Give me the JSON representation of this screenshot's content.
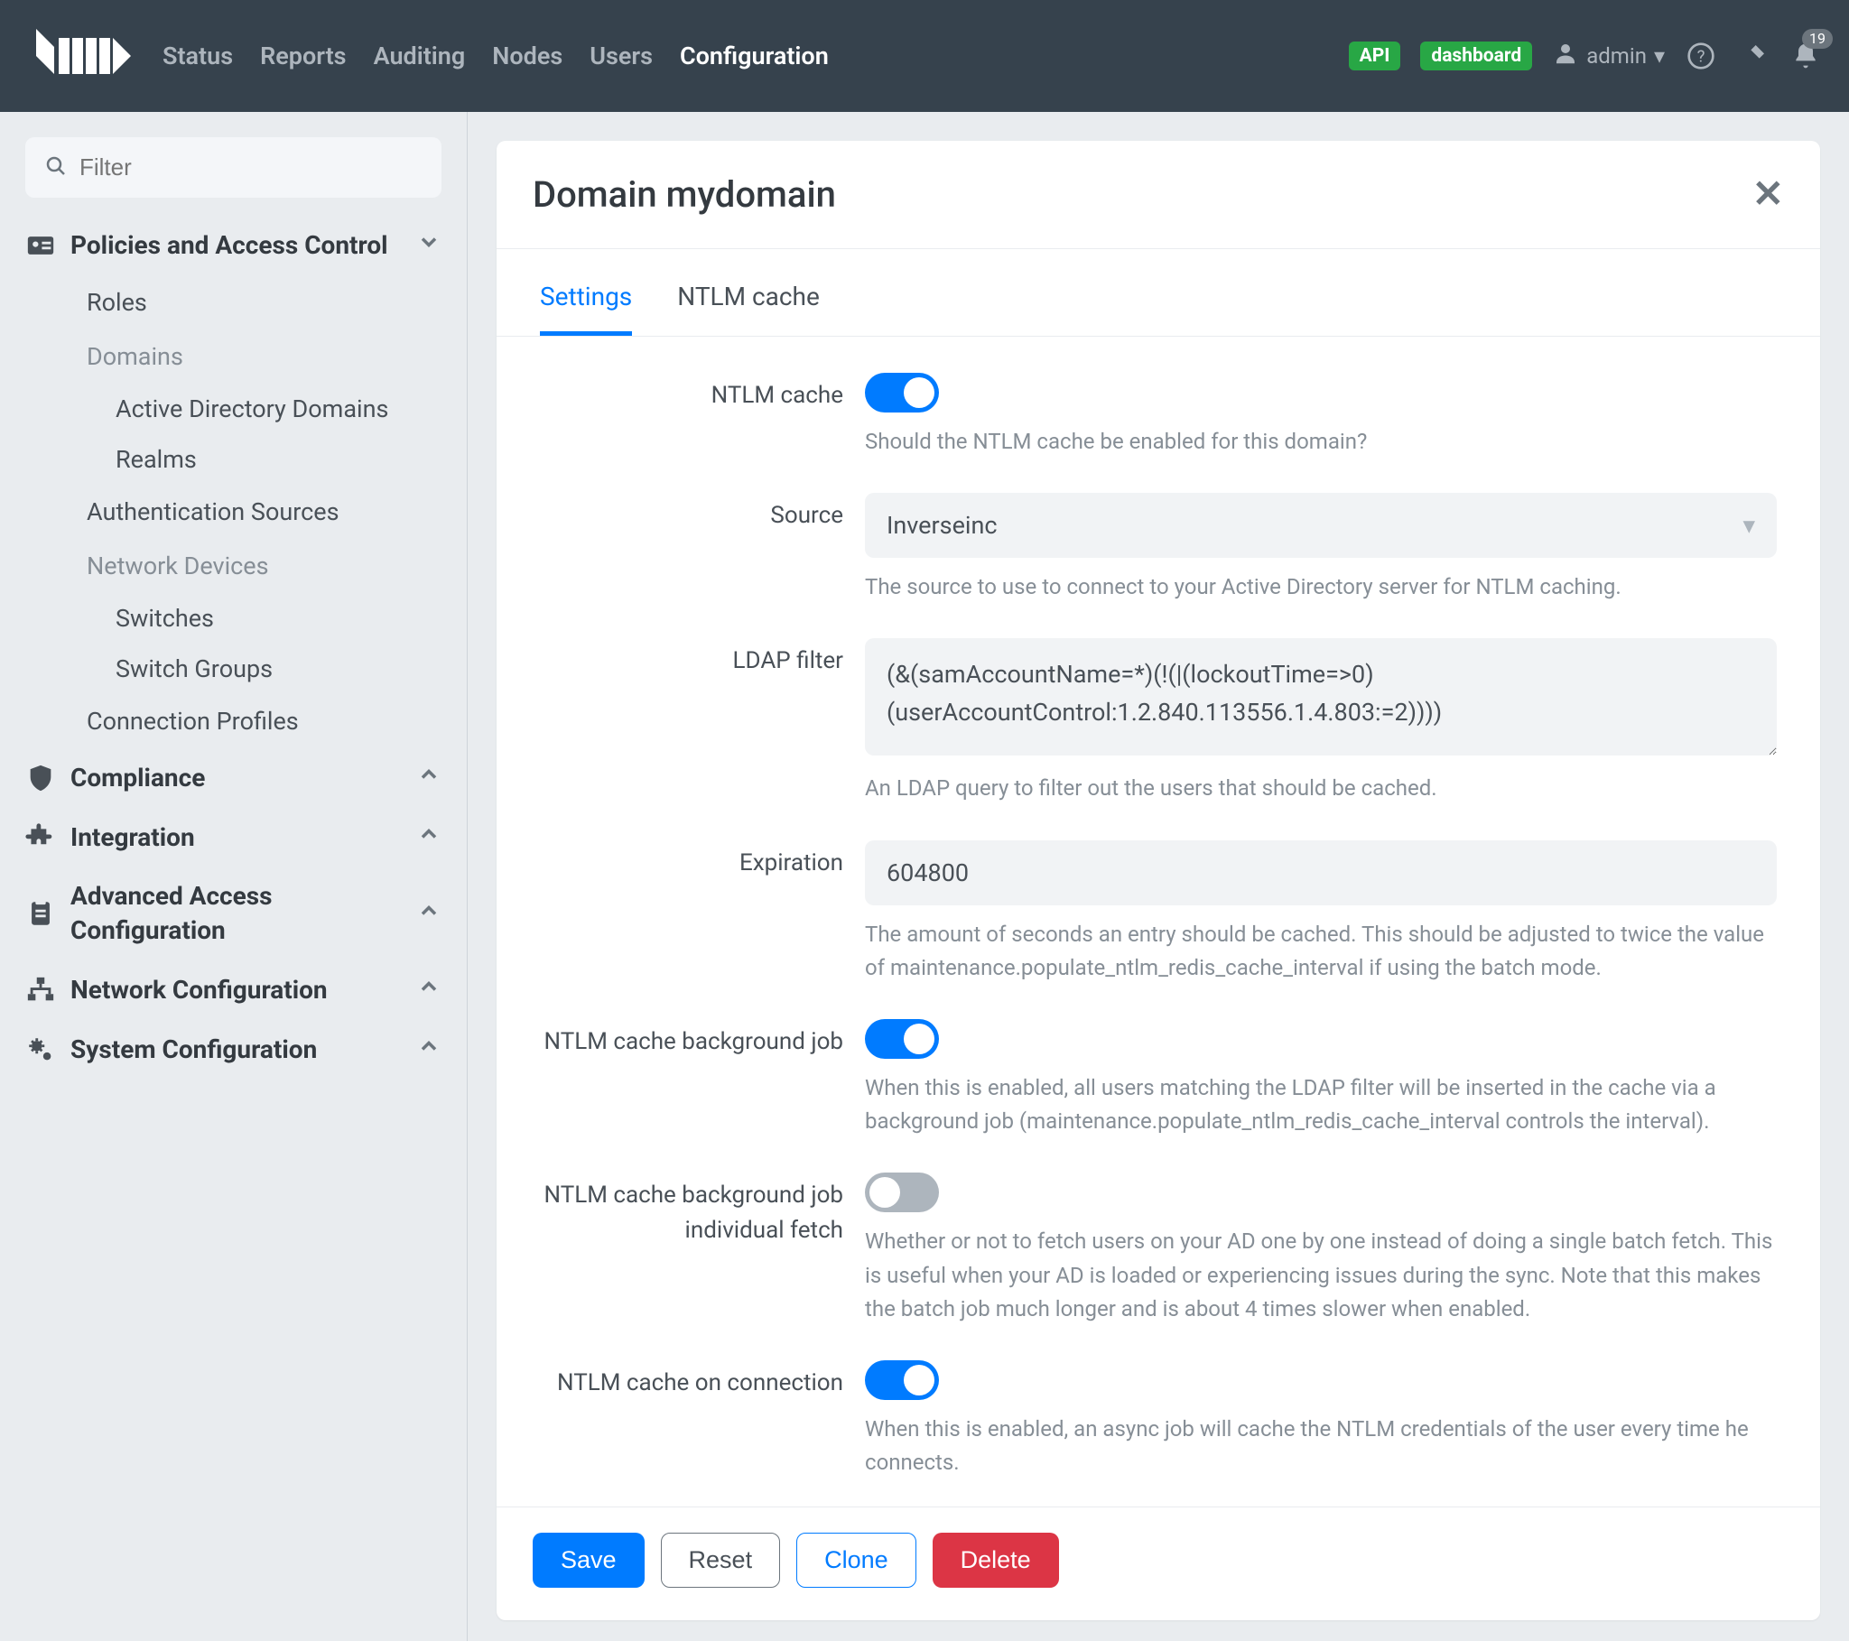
{
  "topnav": {
    "items": [
      "Status",
      "Reports",
      "Auditing",
      "Nodes",
      "Users",
      "Configuration"
    ],
    "active": "Configuration"
  },
  "topright": {
    "api_badge": "API",
    "dashboard_badge": "dashboard",
    "user": "admin",
    "bell_count": "19"
  },
  "sidebar": {
    "filter_placeholder": "Filter",
    "sections": [
      {
        "label": "Policies and Access Control",
        "icon": "id-card",
        "expanded": true,
        "items": [
          {
            "type": "item",
            "label": "Roles"
          },
          {
            "type": "group",
            "label": "Domains",
            "items": [
              {
                "label": "Active Directory Domains"
              },
              {
                "label": "Realms"
              }
            ]
          },
          {
            "type": "item",
            "label": "Authentication Sources"
          },
          {
            "type": "group",
            "label": "Network Devices",
            "items": [
              {
                "label": "Switches"
              },
              {
                "label": "Switch Groups"
              }
            ]
          },
          {
            "type": "item",
            "label": "Connection Profiles"
          }
        ]
      },
      {
        "label": "Compliance",
        "icon": "shield",
        "expanded": false
      },
      {
        "label": "Integration",
        "icon": "puzzle",
        "expanded": false
      },
      {
        "label": "Advanced Access Configuration",
        "icon": "clipboard",
        "expanded": false
      },
      {
        "label": "Network Configuration",
        "icon": "network",
        "expanded": false
      },
      {
        "label": "System Configuration",
        "icon": "cogs",
        "expanded": false
      }
    ]
  },
  "page": {
    "title": "Domain mydomain",
    "tabs": [
      "Settings",
      "NTLM cache"
    ],
    "active_tab": "Settings"
  },
  "form": {
    "ntlm_cache": {
      "label": "NTLM cache",
      "on": true,
      "help": "Should the NTLM cache be enabled for this domain?"
    },
    "source": {
      "label": "Source",
      "value": "Inverseinc",
      "help": "The source to use to connect to your Active Directory server for NTLM caching."
    },
    "ldap_filter": {
      "label": "LDAP filter",
      "value": "(&(samAccountName=*)(!(|(lockoutTime=>0)(userAccountControl:1.2.840.113556.1.4.803:=2))))",
      "help": "An LDAP query to filter out the users that should be cached."
    },
    "expiration": {
      "label": "Expiration",
      "value": "604800",
      "help": "The amount of seconds an entry should be cached. This should be adjusted to twice the value of maintenance.populate_ntlm_redis_cache_interval if using the batch mode."
    },
    "bg_job": {
      "label": "NTLM cache background job",
      "on": true,
      "help": "When this is enabled, all users matching the LDAP filter will be inserted in the cache via a background job (maintenance.populate_ntlm_redis_cache_interval controls the interval)."
    },
    "bg_fetch": {
      "label": "NTLM cache background job individual fetch",
      "on": false,
      "help": "Whether or not to fetch users on your AD one by one instead of doing a single batch fetch. This is useful when your AD is loaded or experiencing issues during the sync. Note that this makes the batch job much longer and is about 4 times slower when enabled."
    },
    "on_conn": {
      "label": "NTLM cache on connection",
      "on": true,
      "help": "When this is enabled, an async job will cache the NTLM credentials of the user every time he connects."
    }
  },
  "footer": {
    "save": "Save",
    "reset": "Reset",
    "clone": "Clone",
    "delete": "Delete"
  }
}
